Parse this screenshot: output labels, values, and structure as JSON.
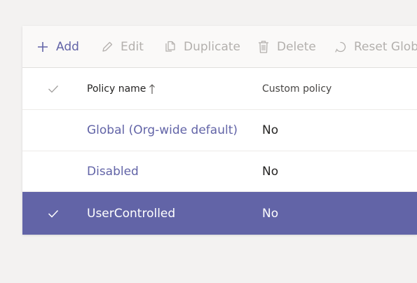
{
  "toolbar": {
    "add_label": "Add",
    "edit_label": "Edit",
    "duplicate_label": "Duplicate",
    "delete_label": "Delete",
    "reset_label": "Reset Global"
  },
  "table": {
    "columns": {
      "name": "Policy name",
      "custom": "Custom policy"
    },
    "rows": [
      {
        "name": "Global (Org-wide default)",
        "custom": "No",
        "selected": false
      },
      {
        "name": "Disabled",
        "custom": "No",
        "selected": false
      },
      {
        "name": "UserControlled",
        "custom": "No",
        "selected": true
      }
    ]
  },
  "colors": {
    "accent": "#6264a7",
    "background": "#f3f2f1",
    "disabled_text": "#b3b0ad"
  }
}
